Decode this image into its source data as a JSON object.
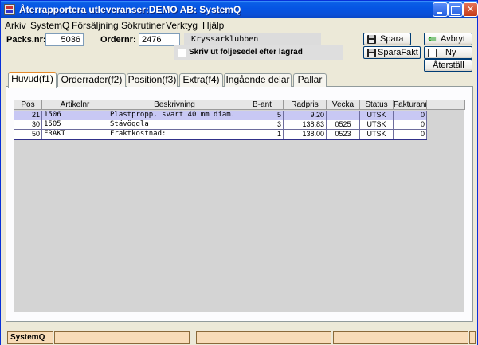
{
  "window": {
    "title": "Återrapportera utleveranser:DEMO AB: SystemQ"
  },
  "menu": [
    "Arkiv",
    "SystemQ",
    "Försäljning",
    "Sökrutiner",
    "Verktyg",
    "Hjälp"
  ],
  "header": {
    "packsnr_label": "Packs.nr:",
    "packsnr_value": "5036",
    "ordernr_label": "Ordernr:",
    "ordernr_value": "2476",
    "customer_name": "Kryssarklubben",
    "print_checkbox_label": "Skriv ut följesedel efter lagrad",
    "print_checkbox_checked": false
  },
  "buttons": {
    "spara": "Spara",
    "avbryt": "Avbryt",
    "sparafakt": "SparaFakt",
    "ny": "Ny",
    "aterstall": "Återställ"
  },
  "tabs": [
    {
      "label": "Huvud(f1)",
      "active": true
    },
    {
      "label": "Orderrader(f2)",
      "active": false
    },
    {
      "label": "Position(f3)",
      "active": false
    },
    {
      "label": "Extra(f4)",
      "active": false
    },
    {
      "label": "Ingående delar",
      "active": false
    },
    {
      "label": "Pallar",
      "active": false
    }
  ],
  "grid": {
    "columns": [
      "Pos",
      "Artikelnr",
      "Beskrivning",
      "B-ant",
      "Radpris",
      "Vecka",
      "Status",
      "Fakturanr"
    ],
    "rows": [
      {
        "pos": "21",
        "artikelnr": "1506",
        "beskrivning": "Plastpropp, svart 40 mm diam.",
        "bant": "5",
        "radpris": "9.20",
        "vecka": "",
        "status": "UTSK",
        "fakturanr": "0",
        "selected": true
      },
      {
        "pos": "30",
        "artikelnr": "1505",
        "beskrivning": "Stävöggla",
        "bant": "3",
        "radpris": "138.83",
        "vecka": "0525",
        "status": "UTSK",
        "fakturanr": "0",
        "selected": false
      },
      {
        "pos": "50",
        "artikelnr": "FRAKT",
        "beskrivning": "Fraktkostnad:",
        "bant": "1",
        "radpris": "138.00",
        "vecka": "0523",
        "status": "UTSK",
        "fakturanr": "0",
        "selected": false
      }
    ]
  },
  "statusbar": [
    "SystemQ",
    "",
    "",
    "",
    ""
  ]
}
